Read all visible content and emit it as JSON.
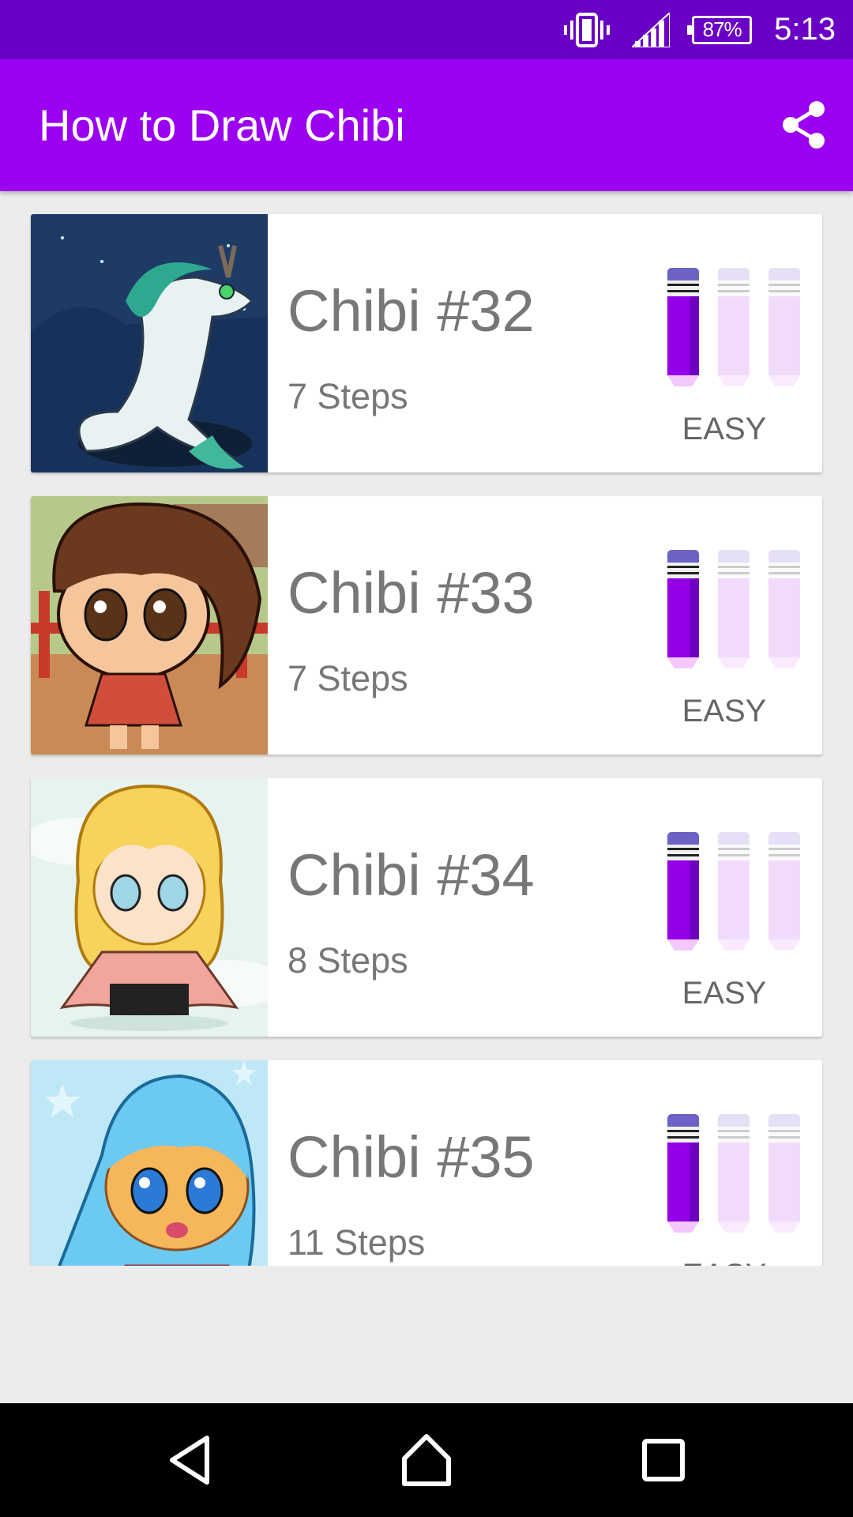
{
  "status_bar": {
    "battery": "87%",
    "time": "5:13"
  },
  "app_bar": {
    "title": "How to Draw Chibi"
  },
  "items": [
    {
      "title": "Chibi #32",
      "steps": "7 Steps",
      "difficulty": "EASY",
      "difficulty_level": 1,
      "difficulty_max": 3
    },
    {
      "title": "Chibi #33",
      "steps": "7 Steps",
      "difficulty": "EASY",
      "difficulty_level": 1,
      "difficulty_max": 3
    },
    {
      "title": "Chibi #34",
      "steps": "8 Steps",
      "difficulty": "EASY",
      "difficulty_level": 1,
      "difficulty_max": 3
    },
    {
      "title": "Chibi #35",
      "steps": "11 Steps",
      "difficulty": "EASY",
      "difficulty_level": 1,
      "difficulty_max": 3
    }
  ],
  "colors": {
    "status_bar": "#6a00c6",
    "app_bar": "#9b00f0",
    "pencil_active": "#9400e8",
    "pencil_inactive": "#f0dcfa"
  },
  "icons": [
    "vibrate-icon",
    "signal-icon",
    "battery-icon",
    "share-icon",
    "back-icon",
    "home-icon",
    "recents-icon"
  ]
}
